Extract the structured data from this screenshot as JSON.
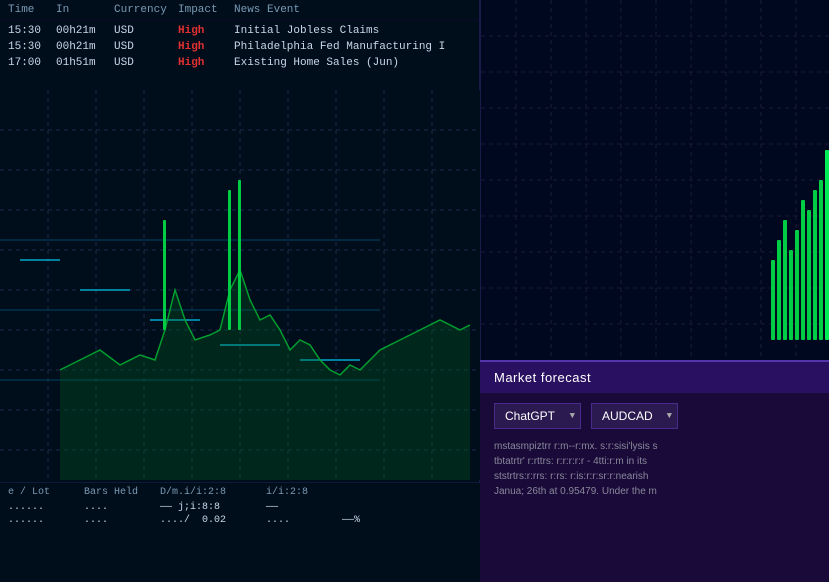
{
  "news_table": {
    "headers": {
      "time": "Time",
      "in": "In",
      "currency": "Currency",
      "impact": "Impact",
      "event": "News Event"
    },
    "rows": [
      {
        "time": "15:30",
        "in": "00h21m",
        "currency": "USD",
        "impact": "High",
        "event": "Initial Jobless Claims"
      },
      {
        "time": "15:30",
        "in": "00h21m",
        "currency": "USD",
        "impact": "High",
        "event": "Philadelphia Fed Manufacturing I"
      },
      {
        "time": "17:00",
        "in": "01h51m",
        "currency": "USD",
        "impact": "High",
        "event": "Existing Home Sales (Jun)"
      }
    ]
  },
  "bottom_bar": {
    "headers": [
      "e / Lot",
      "Bars Held",
      "D/m.i/i:2:8",
      "i/i:2:8",
      ""
    ],
    "rows": [
      [
        "......",
        "....",
        "——  j;i:8:8",
        "——",
        ""
      ],
      [
        "......",
        "....",
        "..../  0.02",
        "....",
        "——%"
      ]
    ]
  },
  "market_forecast": {
    "title": "Market forecast",
    "ai_label": "ChatGPT",
    "pair_label": "AUDCAD",
    "text_lines": [
      "mstasmpiztrr r:m--r:mx. s:r:sisi'lysis s",
      "tbtatrtr' r:rttrs: r:r:r:r:r - 4tti:r:m in its",
      "ststrtrs:r:rrs: r:rs: r:is:r:r:sr:r:nearish",
      "Janua; 26th at 0.95479. Under the m"
    ],
    "ai_options": [
      "ChatGPT"
    ],
    "pair_options": [
      "AUDCAD"
    ]
  },
  "colors": {
    "accent_purple": "#5533aa",
    "dark_bg": "#000d1a",
    "chart_green": "#00cc44",
    "high_impact": "#e03030",
    "header_text": "#7a9bb5",
    "body_text": "#c8d8e8"
  }
}
